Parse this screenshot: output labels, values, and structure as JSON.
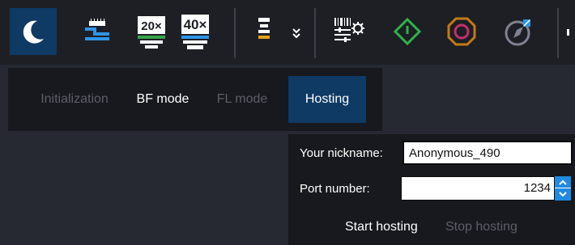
{
  "toolbar": {
    "buttons": [
      {
        "id": "night-mode",
        "icon": "moon-icon",
        "active": true
      },
      {
        "id": "stage",
        "icon": "stage-ruler-icon"
      },
      {
        "id": "objective-20x",
        "icon": "objective-20x-icon",
        "label": "20×"
      },
      {
        "id": "objective-40x",
        "icon": "objective-40x-icon",
        "label": "40×"
      },
      {
        "id": "illumination",
        "icon": "illumination-icon"
      },
      {
        "id": "illumination-dropdown",
        "icon": "chevron-down-icon"
      },
      {
        "id": "barcode",
        "icon": "barcode-settings-icon"
      },
      {
        "id": "start",
        "icon": "power-green-icon"
      },
      {
        "id": "stop",
        "icon": "stop-octagon-icon"
      },
      {
        "id": "navigate",
        "icon": "compass-pen-icon"
      }
    ]
  },
  "tabs": {
    "items": [
      {
        "label": "Initialization",
        "state": "disabled"
      },
      {
        "label": "BF mode",
        "state": "enabled"
      },
      {
        "label": "FL mode",
        "state": "disabled"
      },
      {
        "label": "Hosting",
        "state": "selected"
      }
    ]
  },
  "hosting": {
    "nickname_label": "Your nickname:",
    "nickname_value": "Anonymous_490",
    "port_label": "Port number:",
    "port_value": "1234",
    "start_label": "Start hosting",
    "stop_label": "Stop hosting"
  },
  "colors": {
    "accent": "#0e3a64",
    "spinner": "#1f8ae0",
    "disabled_text": "#5c5f68"
  }
}
